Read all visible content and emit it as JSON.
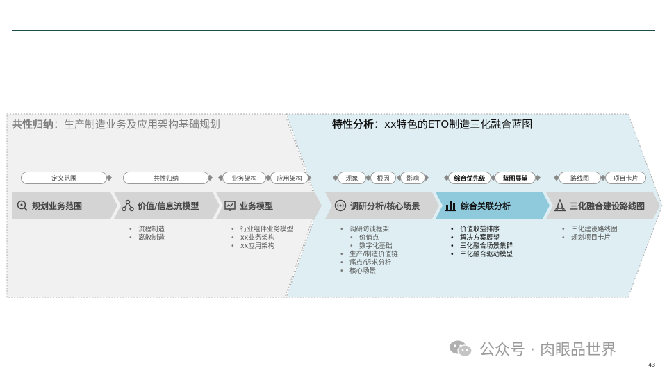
{
  "headers": {
    "left_bold": "共性归纳",
    "left_rest": "：生产制造业务及应用架构基础规划",
    "right_bold": "特性分析",
    "right_rest": "：xx特色的ETO制造三化融合蓝图"
  },
  "pills": [
    "定义范围",
    "共性归纳",
    "业务架构",
    "应用架构",
    "现象",
    "根因",
    "影响",
    "综合优先级",
    "蓝图展望",
    "路线图",
    "项目卡片"
  ],
  "stages": [
    "规划业务范围",
    "价值/信息流模型",
    "业务模型",
    "调研分析/核心场景",
    "综合关联分析",
    "三化融合建设路线图"
  ],
  "lists": {
    "value_flow": [
      "流程制造",
      "离散制造"
    ],
    "business_model": [
      "行业组件业务模型",
      "xx业务架构",
      "xx应用架构"
    ],
    "research": [
      "调研访谈框架",
      "价值点",
      "数字化基础",
      "生产/制造价值链",
      "痛点/诉求分析",
      "核心场景"
    ],
    "comprehensive": [
      "价值收益排序",
      "解决方案展望",
      "三化融合场景集群",
      "三化融合驱动模型"
    ],
    "roadmap": [
      "三化建设路线图",
      "规划项目卡片"
    ]
  },
  "watermark": "公众号 · 肉眼品世界",
  "page_number": "43",
  "colors": {
    "left_panel": "#f1f1f1",
    "right_panel": "#deeef3",
    "stage_gray": "#d4d4d4",
    "stage_highlight": "#8ec9dc",
    "rule": "#1f4e4a"
  }
}
